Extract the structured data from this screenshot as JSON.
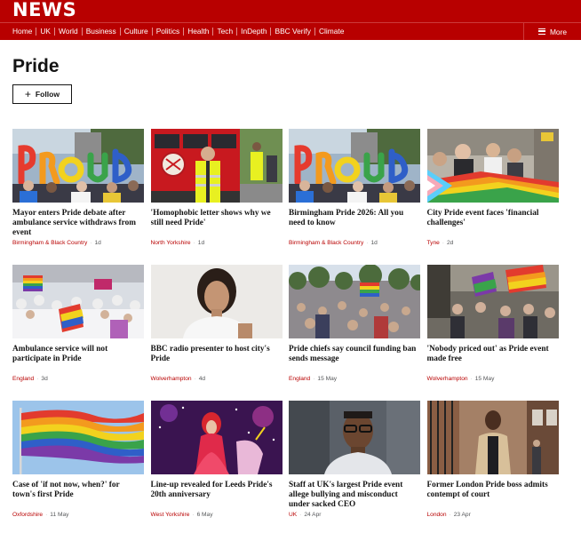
{
  "brand": {
    "logo": "NEWS"
  },
  "nav": {
    "items": [
      "Home",
      "UK",
      "World",
      "Business",
      "Culture",
      "Politics",
      "Health",
      "Tech",
      "InDepth",
      "BBC Verify",
      "Climate"
    ],
    "more_label": "More"
  },
  "page": {
    "title": "Pride",
    "follow_label": "Follow"
  },
  "colors": {
    "brand_red": "#b80000",
    "location_red": "#b80000",
    "text": "#141414"
  },
  "articles": [
    {
      "headline": "Mayor enters Pride debate after ambulance service withdraws from event",
      "location": "Birmingham & Black Country",
      "time": "1d",
      "image": "pride-balloon-letters"
    },
    {
      "headline": "'Homophobic letter shows why we still need Pride'",
      "location": "North Yorkshire",
      "time": "1d",
      "image": "man-in-hi-vis-by-bus"
    },
    {
      "headline": "Birmingham Pride 2026: All you need to know",
      "location": "Birmingham & Black Country",
      "time": "1d",
      "image": "pride-balloon-letters"
    },
    {
      "headline": "City Pride event faces 'financial challenges'",
      "location": "Tyne",
      "time": "2d",
      "image": "crowd-with-progress-flag"
    },
    {
      "headline": "Ambulance service will not participate in Pride",
      "location": "England",
      "time": "3d",
      "image": "parade-crowd-rainbow-flags"
    },
    {
      "headline": "BBC radio presenter to host city's Pride",
      "location": "Wolverhampton",
      "time": "4d",
      "image": "presenter-portrait"
    },
    {
      "headline": "Pride chiefs say council funding ban sends message",
      "location": "England",
      "time": "15 May",
      "image": "large-park-crowd"
    },
    {
      "headline": "'Nobody priced out' as Pride event made free",
      "location": "Wolverhampton",
      "time": "15 May",
      "image": "street-crowd-flags"
    },
    {
      "headline": "Case of 'if not now, when?' for town's first Pride",
      "location": "Oxfordshire",
      "time": "11 May",
      "image": "rainbow-flag-sky"
    },
    {
      "headline": "Line-up revealed for Leeds Pride's 20th anniversary",
      "location": "West Yorkshire",
      "time": "6 May",
      "image": "performer-on-stage"
    },
    {
      "headline": "Staff at UK's largest Pride event allege bullying and misconduct under sacked CEO",
      "location": "UK",
      "time": "24 Apr",
      "image": "man-with-glasses-portrait"
    },
    {
      "headline": "Former London Pride boss admits contempt of court",
      "location": "London",
      "time": "23 Apr",
      "image": "man-walking-street"
    }
  ]
}
